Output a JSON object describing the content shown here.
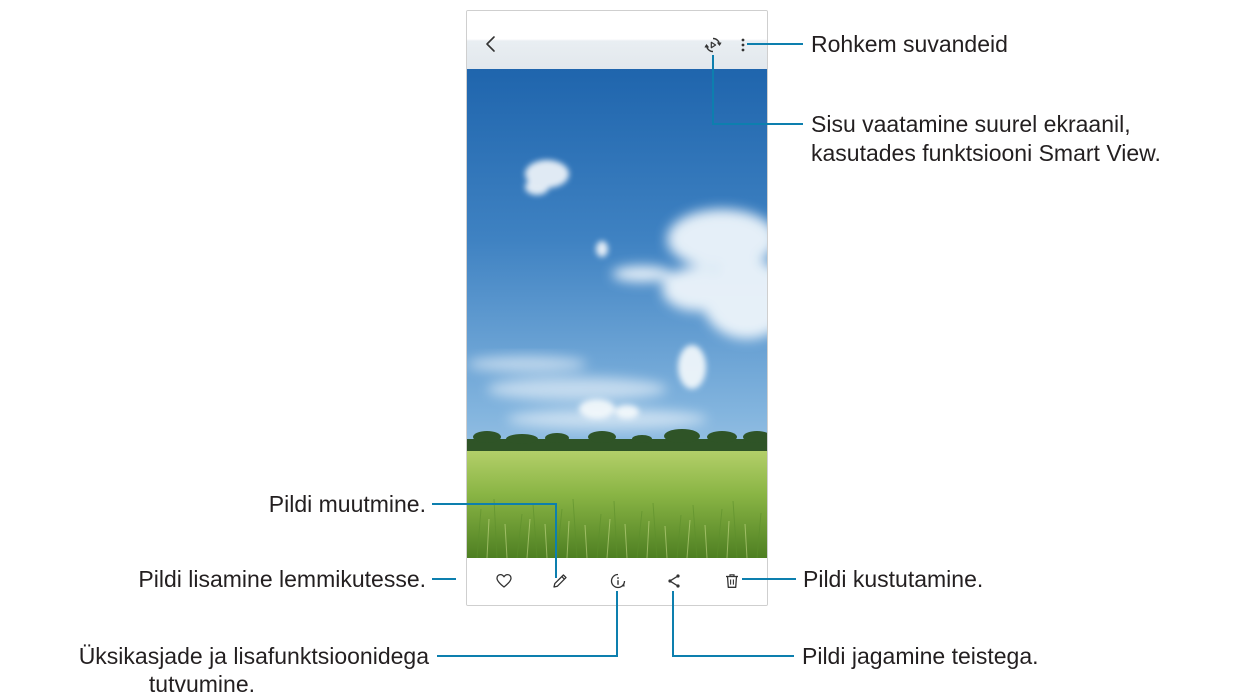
{
  "callouts": {
    "more_options": "Rohkem suvandeid",
    "smart_view_line1": "Sisu vaatamine suurel ekraanil,",
    "smart_view_line2": "kasutades funktsiooni Smart View.",
    "edit": "Pildi muutmine.",
    "favourite": "Pildi lisamine lemmikutesse.",
    "details_line1": "Üksikasjade ja lisafunktsioonidega",
    "details_line2": "tutvumine.",
    "delete": "Pildi kustutamine.",
    "share": "Pildi jagamine teistega."
  },
  "icons": {
    "top": [
      "back-icon",
      "smart-view-icon",
      "more-options-icon"
    ],
    "bottom": [
      "heart-icon",
      "pencil-icon",
      "details-icon",
      "share-icon",
      "trash-icon"
    ]
  },
  "colors": {
    "callout_line": "#0d7fae",
    "text": "#231f20"
  }
}
